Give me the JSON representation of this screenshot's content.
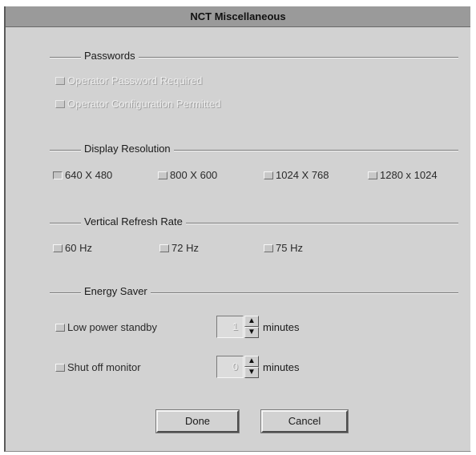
{
  "window": {
    "title": "NCT Miscellaneous"
  },
  "passwords": {
    "title": "Passwords",
    "options": [
      {
        "label": "Operator Password Required",
        "checked": false,
        "enabled": false
      },
      {
        "label": "Operator Configuration Permitted",
        "checked": false,
        "enabled": false
      }
    ]
  },
  "display_resolution": {
    "title": "Display Resolution",
    "options": [
      {
        "label": "640 X 480",
        "selected": true
      },
      {
        "label": "800 X 600",
        "selected": false
      },
      {
        "label": "1024 X 768",
        "selected": false
      },
      {
        "label": "1280 x 1024",
        "selected": false
      }
    ]
  },
  "refresh_rate": {
    "title": "Vertical Refresh Rate",
    "options": [
      {
        "label": "60 Hz",
        "selected": false
      },
      {
        "label": "72 Hz",
        "selected": false
      },
      {
        "label": "75 Hz",
        "selected": false
      }
    ]
  },
  "energy_saver": {
    "title": "Energy Saver",
    "standby": {
      "label": "Low power standby",
      "checked": false,
      "value": "1",
      "unit": "minutes"
    },
    "shutoff": {
      "label": "Shut off monitor",
      "checked": false,
      "value": "0",
      "unit": "minutes"
    }
  },
  "buttons": {
    "done": "Done",
    "cancel": "Cancel"
  }
}
